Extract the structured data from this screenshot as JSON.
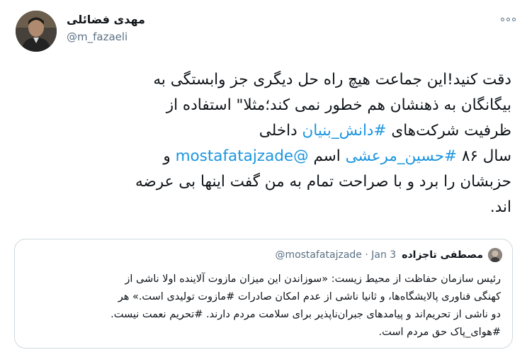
{
  "author": {
    "name": "مهدی فضائلی",
    "handle": "@m_fazaeli"
  },
  "tweet": {
    "lines": [
      [
        {
          "text": "دقت کنید!این جماعت هیچ راه حل دیگری جز وابستگی به",
          "link": false
        }
      ],
      [
        {
          "text": "بیگانگان به ذهنشان هم خطور نمی کند؛مثلا\" استفاده از",
          "link": false
        }
      ],
      [
        {
          "text": "ظرفیت شرکت‌های ",
          "link": false
        },
        {
          "text": "#دانش_بنیان",
          "link": true
        },
        {
          "text": " داخلی",
          "link": false
        }
      ],
      [
        {
          "text": "سال ۸۶ ",
          "link": false
        },
        {
          "text": "#حسین_مرعشی",
          "link": true
        },
        {
          "text": " اسم ",
          "link": false
        },
        {
          "text": "@mostafatajzade",
          "link": true
        },
        {
          "text": " و",
          "link": false
        }
      ],
      [
        {
          "text": "حزبشان را برد و با صراحت تمام به من گفت اینها بی عرضه",
          "link": false
        }
      ],
      [
        {
          "text": "اند.",
          "link": false
        }
      ]
    ]
  },
  "quote": {
    "name": "مصطفی تاجزاده",
    "handle": "@mostafatajzade",
    "separator": "·",
    "date": "Jan 3",
    "lines": [
      "رئیس سازمان حفاظت از محیط زیست: «سوزاندن این میزان مازوت آلاینده اولا ناشی از",
      "کهنگی فناوری پالایشگاه‌ها، و ثانیا ناشی از عدم امکان صادرات #مازوت تولیدی است.» هر",
      "دو ناشی از تحریم‌اند و پیامدهای جبران‌ناپذیر برای سلامت مردم دارند. #تحریم نعمت نیست.",
      "#هوای_پاک حق مردم است."
    ]
  },
  "icons": {
    "more": "more-horizontal-icon"
  },
  "colors": {
    "link": "#1b95e0",
    "secondary_text": "#5b7083",
    "border": "#cfd9de"
  }
}
